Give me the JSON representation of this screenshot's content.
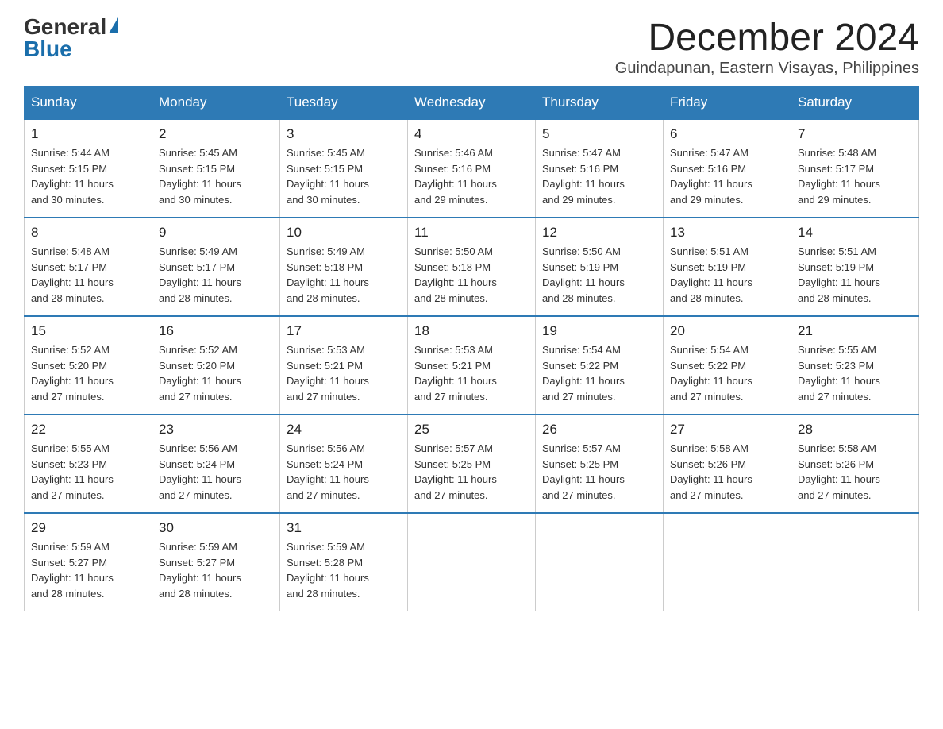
{
  "logo": {
    "general": "General",
    "blue": "Blue"
  },
  "header": {
    "month": "December 2024",
    "location": "Guindapunan, Eastern Visayas, Philippines"
  },
  "weekdays": [
    "Sunday",
    "Monday",
    "Tuesday",
    "Wednesday",
    "Thursday",
    "Friday",
    "Saturday"
  ],
  "weeks": [
    [
      {
        "day": "1",
        "sunrise": "5:44 AM",
        "sunset": "5:15 PM",
        "daylight": "11 hours and 30 minutes."
      },
      {
        "day": "2",
        "sunrise": "5:45 AM",
        "sunset": "5:15 PM",
        "daylight": "11 hours and 30 minutes."
      },
      {
        "day": "3",
        "sunrise": "5:45 AM",
        "sunset": "5:15 PM",
        "daylight": "11 hours and 30 minutes."
      },
      {
        "day": "4",
        "sunrise": "5:46 AM",
        "sunset": "5:16 PM",
        "daylight": "11 hours and 29 minutes."
      },
      {
        "day": "5",
        "sunrise": "5:47 AM",
        "sunset": "5:16 PM",
        "daylight": "11 hours and 29 minutes."
      },
      {
        "day": "6",
        "sunrise": "5:47 AM",
        "sunset": "5:16 PM",
        "daylight": "11 hours and 29 minutes."
      },
      {
        "day": "7",
        "sunrise": "5:48 AM",
        "sunset": "5:17 PM",
        "daylight": "11 hours and 29 minutes."
      }
    ],
    [
      {
        "day": "8",
        "sunrise": "5:48 AM",
        "sunset": "5:17 PM",
        "daylight": "11 hours and 28 minutes."
      },
      {
        "day": "9",
        "sunrise": "5:49 AM",
        "sunset": "5:17 PM",
        "daylight": "11 hours and 28 minutes."
      },
      {
        "day": "10",
        "sunrise": "5:49 AM",
        "sunset": "5:18 PM",
        "daylight": "11 hours and 28 minutes."
      },
      {
        "day": "11",
        "sunrise": "5:50 AM",
        "sunset": "5:18 PM",
        "daylight": "11 hours and 28 minutes."
      },
      {
        "day": "12",
        "sunrise": "5:50 AM",
        "sunset": "5:19 PM",
        "daylight": "11 hours and 28 minutes."
      },
      {
        "day": "13",
        "sunrise": "5:51 AM",
        "sunset": "5:19 PM",
        "daylight": "11 hours and 28 minutes."
      },
      {
        "day": "14",
        "sunrise": "5:51 AM",
        "sunset": "5:19 PM",
        "daylight": "11 hours and 28 minutes."
      }
    ],
    [
      {
        "day": "15",
        "sunrise": "5:52 AM",
        "sunset": "5:20 PM",
        "daylight": "11 hours and 27 minutes."
      },
      {
        "day": "16",
        "sunrise": "5:52 AM",
        "sunset": "5:20 PM",
        "daylight": "11 hours and 27 minutes."
      },
      {
        "day": "17",
        "sunrise": "5:53 AM",
        "sunset": "5:21 PM",
        "daylight": "11 hours and 27 minutes."
      },
      {
        "day": "18",
        "sunrise": "5:53 AM",
        "sunset": "5:21 PM",
        "daylight": "11 hours and 27 minutes."
      },
      {
        "day": "19",
        "sunrise": "5:54 AM",
        "sunset": "5:22 PM",
        "daylight": "11 hours and 27 minutes."
      },
      {
        "day": "20",
        "sunrise": "5:54 AM",
        "sunset": "5:22 PM",
        "daylight": "11 hours and 27 minutes."
      },
      {
        "day": "21",
        "sunrise": "5:55 AM",
        "sunset": "5:23 PM",
        "daylight": "11 hours and 27 minutes."
      }
    ],
    [
      {
        "day": "22",
        "sunrise": "5:55 AM",
        "sunset": "5:23 PM",
        "daylight": "11 hours and 27 minutes."
      },
      {
        "day": "23",
        "sunrise": "5:56 AM",
        "sunset": "5:24 PM",
        "daylight": "11 hours and 27 minutes."
      },
      {
        "day": "24",
        "sunrise": "5:56 AM",
        "sunset": "5:24 PM",
        "daylight": "11 hours and 27 minutes."
      },
      {
        "day": "25",
        "sunrise": "5:57 AM",
        "sunset": "5:25 PM",
        "daylight": "11 hours and 27 minutes."
      },
      {
        "day": "26",
        "sunrise": "5:57 AM",
        "sunset": "5:25 PM",
        "daylight": "11 hours and 27 minutes."
      },
      {
        "day": "27",
        "sunrise": "5:58 AM",
        "sunset": "5:26 PM",
        "daylight": "11 hours and 27 minutes."
      },
      {
        "day": "28",
        "sunrise": "5:58 AM",
        "sunset": "5:26 PM",
        "daylight": "11 hours and 27 minutes."
      }
    ],
    [
      {
        "day": "29",
        "sunrise": "5:59 AM",
        "sunset": "5:27 PM",
        "daylight": "11 hours and 28 minutes."
      },
      {
        "day": "30",
        "sunrise": "5:59 AM",
        "sunset": "5:27 PM",
        "daylight": "11 hours and 28 minutes."
      },
      {
        "day": "31",
        "sunrise": "5:59 AM",
        "sunset": "5:28 PM",
        "daylight": "11 hours and 28 minutes."
      },
      null,
      null,
      null,
      null
    ]
  ],
  "labels": {
    "sunrise": "Sunrise:",
    "sunset": "Sunset:",
    "daylight": "Daylight:"
  }
}
